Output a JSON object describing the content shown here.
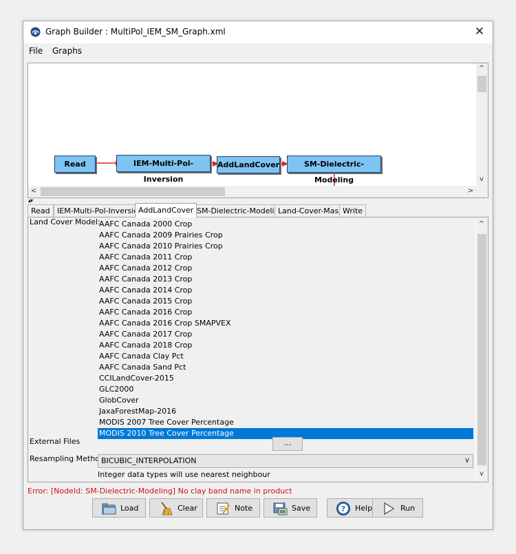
{
  "window": {
    "title": "Graph Builder : MultiPol_IEM_SM_Graph.xml",
    "close_label": "✕",
    "icon": "snap-app-icon"
  },
  "menubar": {
    "items": [
      "File",
      "Graphs"
    ]
  },
  "graph": {
    "nodes": [
      {
        "label": "Read"
      },
      {
        "label": "IEM-Multi-Pol-Inversion"
      },
      {
        "label": "AddLandCover"
      },
      {
        "label": "SM-Dielectric-Modeling"
      }
    ],
    "edge_color": "#e02020",
    "node_color": "#7ec4f2"
  },
  "scroll_arrows": {
    "up": "^",
    "down": "v",
    "left": "<",
    "right": ">"
  },
  "splitter_label": "▴▾",
  "tabs": [
    {
      "label": "Read",
      "active": false
    },
    {
      "label": "IEM-Multi-Pol-Inversion",
      "active": false
    },
    {
      "label": "AddLandCover",
      "active": true
    },
    {
      "label": "SM-Dielectric-Modeling",
      "active": false
    },
    {
      "label": "Land-Cover-Mask",
      "active": false
    },
    {
      "label": "Write",
      "active": false
    }
  ],
  "land_cover_panel": {
    "model_label": "Land Cover Model:",
    "items": [
      {
        "label": "AAFC Canada 2000 Crop",
        "selected": false
      },
      {
        "label": "AAFC Canada 2009 Prairies Crop",
        "selected": false
      },
      {
        "label": "AAFC Canada 2010 Prairies Crop",
        "selected": false
      },
      {
        "label": "AAFC Canada 2011 Crop",
        "selected": false
      },
      {
        "label": "AAFC Canada 2012 Crop",
        "selected": false
      },
      {
        "label": "AAFC Canada 2013 Crop",
        "selected": false
      },
      {
        "label": "AAFC Canada 2014 Crop",
        "selected": false
      },
      {
        "label": "AAFC Canada 2015 Crop",
        "selected": false
      },
      {
        "label": "AAFC Canada 2016 Crop",
        "selected": false
      },
      {
        "label": "AAFC Canada 2016 Crop SMAPVEX",
        "selected": false
      },
      {
        "label": "AAFC Canada 2017 Crop",
        "selected": false
      },
      {
        "label": "AAFC Canada 2018 Crop",
        "selected": false
      },
      {
        "label": "AAFC Canada Clay Pct",
        "selected": false
      },
      {
        "label": "AAFC Canada Sand Pct",
        "selected": false
      },
      {
        "label": "CCILandCover-2015",
        "selected": false
      },
      {
        "label": "GLC2000",
        "selected": false
      },
      {
        "label": "GlobCover",
        "selected": false
      },
      {
        "label": "JaxaForestMap-2016",
        "selected": false
      },
      {
        "label": "MODIS 2007 Tree Cover Percentage",
        "selected": false
      },
      {
        "label": "MODIS 2010 Tree Cover Percentage",
        "selected": true
      }
    ],
    "external_files_label": "External Files",
    "browse_label": "...",
    "resampling_label": "Resampling Method:",
    "resampling_value": "BICUBIC_INTERPOLATION",
    "select_arrow": "∨",
    "integer_note": "Integer data types will use nearest neighbour"
  },
  "error_message": "Error: [NodeId: SM-Dielectric-Modeling] No clay band name in product",
  "buttons": [
    {
      "label": "Load",
      "icon": "folder-icon"
    },
    {
      "label": "Clear",
      "icon": "broom-icon"
    },
    {
      "label": "Note",
      "icon": "note-icon"
    },
    {
      "label": "Save",
      "icon": "save-icon"
    },
    {
      "label": "Help",
      "icon": "help-icon"
    },
    {
      "label": "Run",
      "icon": "play-icon"
    }
  ],
  "colors": {
    "selection": "#0078d7",
    "error": "#d01010"
  }
}
